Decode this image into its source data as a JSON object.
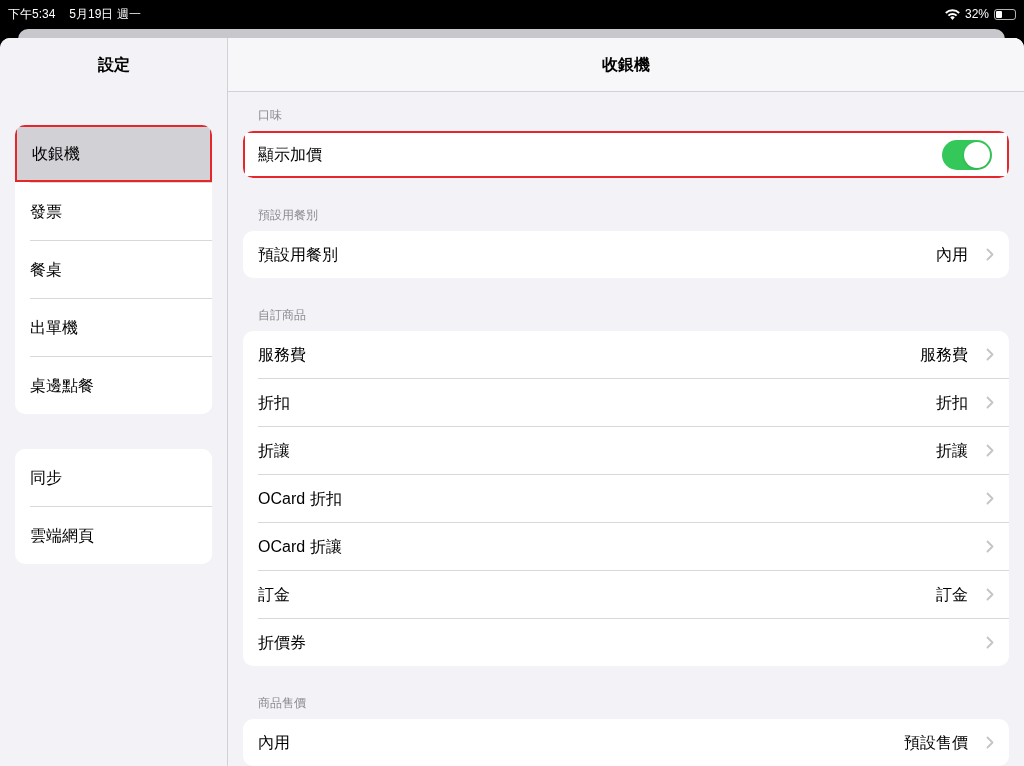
{
  "status_bar": {
    "time": "下午5:34",
    "date": "5月19日 週一",
    "battery": "32%"
  },
  "sidebar": {
    "title": "設定",
    "groups": [
      {
        "items": [
          {
            "label": "收銀機",
            "selected": true,
            "highlighted": true
          },
          {
            "label": "發票",
            "selected": false,
            "highlighted": false
          },
          {
            "label": "餐桌",
            "selected": false,
            "highlighted": false
          },
          {
            "label": "出單機",
            "selected": false,
            "highlighted": false
          },
          {
            "label": "桌邊點餐",
            "selected": false,
            "highlighted": false
          }
        ]
      },
      {
        "items": [
          {
            "label": "同步",
            "selected": false,
            "highlighted": false
          },
          {
            "label": "雲端網頁",
            "selected": false,
            "highlighted": false
          }
        ]
      }
    ]
  },
  "detail": {
    "title": "收銀機",
    "sections": [
      {
        "header": "口味",
        "rows": [
          {
            "kind": "toggle",
            "label": "顯示加價",
            "on": true,
            "highlighted": true
          }
        ]
      },
      {
        "header": "預設用餐別",
        "rows": [
          {
            "kind": "link",
            "label": "預設用餐別",
            "value": "內用",
            "highlighted": false
          }
        ]
      },
      {
        "header": "自訂商品",
        "rows": [
          {
            "kind": "link",
            "label": "服務費",
            "value": "服務費",
            "highlighted": false
          },
          {
            "kind": "link",
            "label": "折扣",
            "value": "折扣",
            "highlighted": false
          },
          {
            "kind": "link",
            "label": "折讓",
            "value": "折讓",
            "highlighted": false
          },
          {
            "kind": "link",
            "label": "OCard 折扣",
            "highlighted": false
          },
          {
            "kind": "link",
            "label": "OCard 折讓",
            "highlighted": false
          },
          {
            "kind": "link",
            "label": "訂金",
            "value": "訂金",
            "highlighted": false
          },
          {
            "kind": "link",
            "label": "折價券",
            "highlighted": false
          }
        ]
      },
      {
        "header": "商品售價",
        "rows": [
          {
            "kind": "link",
            "label": "內用",
            "value": "預設售價",
            "highlighted": false
          }
        ]
      }
    ]
  }
}
